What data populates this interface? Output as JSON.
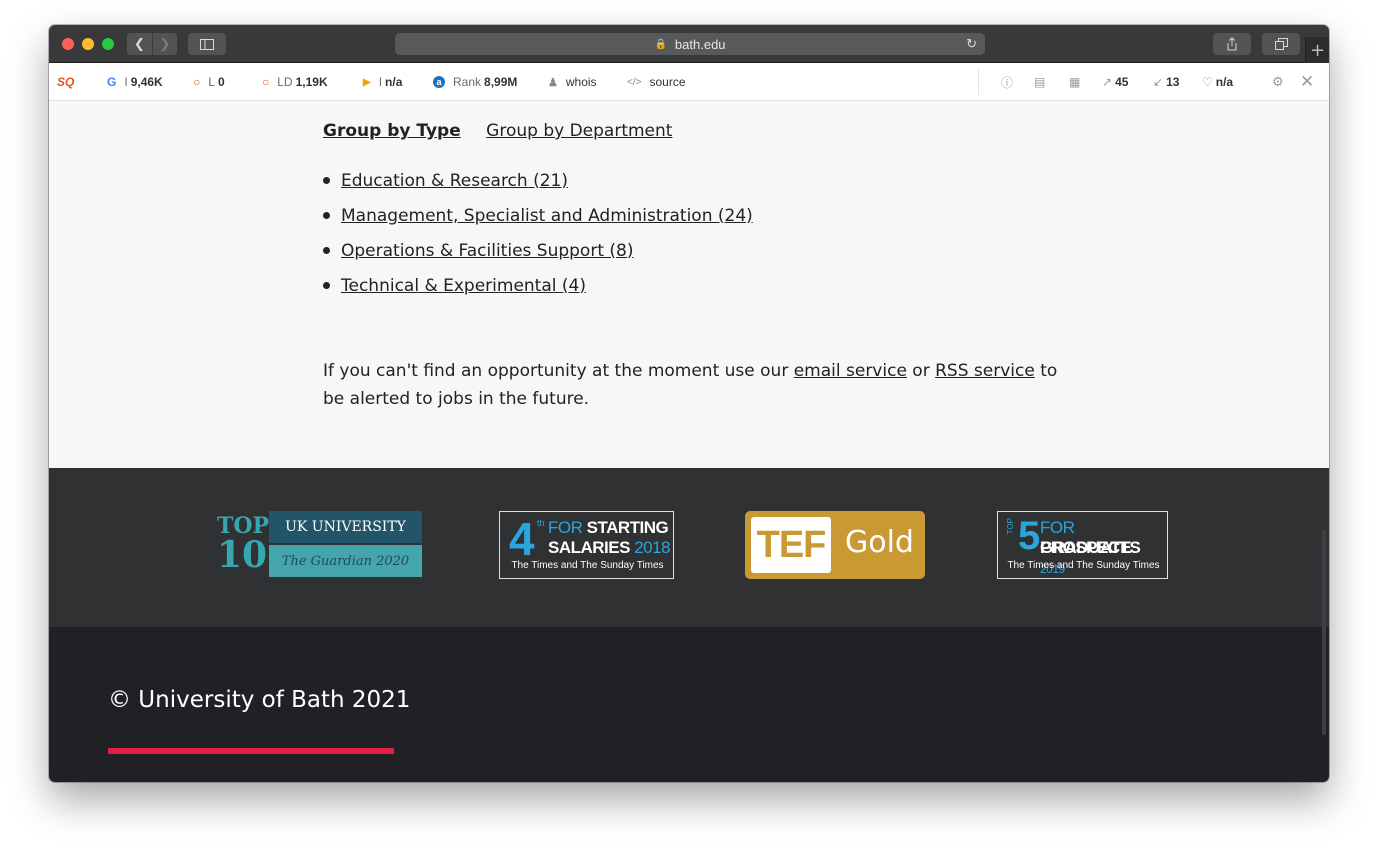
{
  "browser": {
    "url": "bath.edu"
  },
  "seo_toolbar": {
    "logo": "SQ",
    "items": [
      {
        "icon": "G",
        "label": "I",
        "value": "9,46K"
      },
      {
        "icon": "○",
        "label": "L",
        "value": "0"
      },
      {
        "icon": "○",
        "label": "LD",
        "value": "1,19K"
      },
      {
        "icon": "▶",
        "label": "I",
        "value": "n/a"
      },
      {
        "icon": "a",
        "label": "Rank",
        "value": "8,99M"
      },
      {
        "icon": "👤",
        "label": "",
        "value": "whois"
      },
      {
        "icon": "</>",
        "label": "",
        "value": "source"
      }
    ],
    "right": {
      "external_links": "45",
      "internal_links": "13",
      "health": "n/a"
    }
  },
  "content": {
    "group_by_type": "Group by Type",
    "group_by_department": "Group by Department",
    "job_types": [
      "Education & Research (21)",
      "Management, Specialist and Administration (24)",
      "Operations & Facilities Support (8)",
      "Technical & Experimental (4)"
    ],
    "notice_before": "If you can't find an opportunity at the moment use our ",
    "email_service": "email service",
    "notice_or": " or ",
    "rss_service": "RSS service",
    "notice_after": " to be alerted to jobs in the future."
  },
  "awards": {
    "guardian": {
      "top": "TOP",
      "ten": "10",
      "line1": "UK UNIVERSITY",
      "line2": "The Guardian 2020"
    },
    "salaries": {
      "rank": "4",
      "suffix": "th",
      "for": "FOR",
      "starting": "STARTING",
      "salaries": "SALARIES",
      "year": "2018",
      "source": "The Times and The Sunday Times"
    },
    "tef": {
      "tef": "TEF",
      "gold": "Gold"
    },
    "graduate": {
      "top": "TOP",
      "rank": "5",
      "for": "FOR",
      "graduate": "GRADUATE",
      "prospects": "PROSPECTS",
      "year": "2019",
      "source": "The Times and The Sunday Times"
    }
  },
  "footer": {
    "copyright": "© University of Bath 2021"
  },
  "colors": {
    "accent_red": "#e51d44",
    "footer_bg": "#1f2124",
    "awards_bg": "#2f3133"
  }
}
